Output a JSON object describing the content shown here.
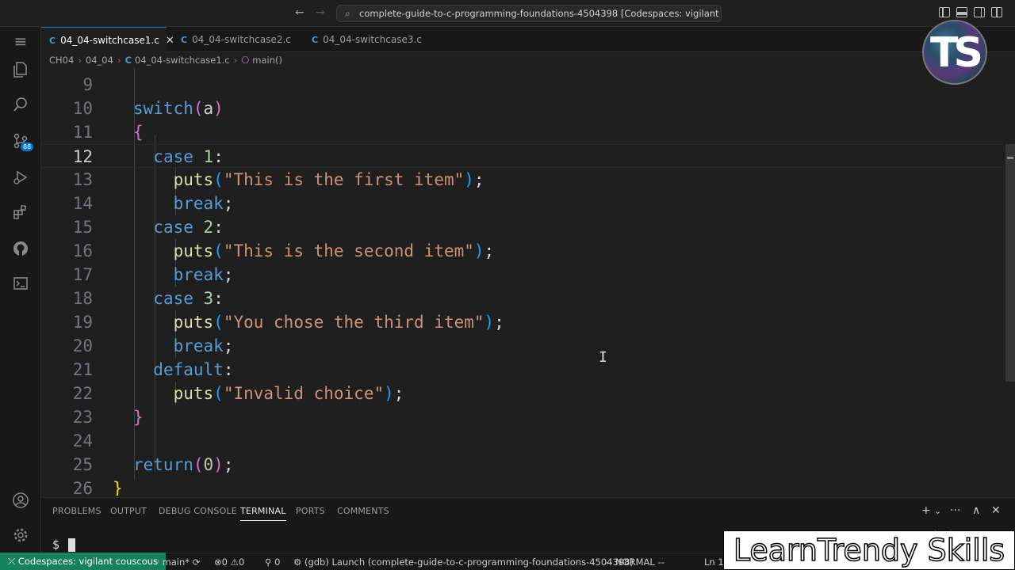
{
  "titlebar": {
    "back_icon": "←",
    "forward_icon": "→",
    "command_center": "complete-guide-to-c-programming-foundations-4504398 [Codespaces: vigilant couscous]"
  },
  "activity_bar": {
    "menu_icon": "≡",
    "extensions_badge": "88"
  },
  "tabs": [
    {
      "icon": "C",
      "label": "04_04-switchcase1.c",
      "close": "✕"
    },
    {
      "icon": "C",
      "label": "04_04-switchcase2.c"
    },
    {
      "icon": "C",
      "label": "04_04-switchcase3.c"
    }
  ],
  "breadcrumb": {
    "items": [
      "CH04",
      "04_04",
      "04_04-switchcase1.c",
      "main()"
    ],
    "file_icon": "C",
    "fn_icon": "⎔"
  },
  "editor": {
    "line_numbers": [
      "9",
      "10",
      "11",
      "12",
      "13",
      "14",
      "15",
      "16",
      "17",
      "18",
      "19",
      "20",
      "21",
      "22",
      "23",
      "24",
      "25",
      "26"
    ],
    "current_line": "12",
    "code": {
      "l10": {
        "kw": "switch",
        "open": "(",
        "var": "a",
        "close": ")"
      },
      "l11": "{",
      "l12": {
        "kw": "case",
        "num": "1",
        "colon": ":"
      },
      "l13": {
        "fn": "puts",
        "open": "(",
        "str": "\"This is the first item\"",
        "close": ")",
        "semi": ";"
      },
      "l14": {
        "kw": "break",
        "semi": ";"
      },
      "l15": {
        "kw": "case",
        "num": "2",
        "colon": ":"
      },
      "l16": {
        "fn": "puts",
        "open": "(",
        "str": "\"This is the second item\"",
        "close": ")",
        "semi": ";"
      },
      "l17": {
        "kw": "break",
        "semi": ";"
      },
      "l18": {
        "kw": "case",
        "num": "3",
        "colon": ":"
      },
      "l19": {
        "fn": "puts",
        "open": "(",
        "str": "\"You chose the third item\"",
        "close": ")",
        "semi": ";"
      },
      "l20": {
        "kw": "break",
        "semi": ";"
      },
      "l21": {
        "kw": "default",
        "colon": ":"
      },
      "l22": {
        "fn": "puts",
        "open": "(",
        "str": "\"Invalid choice\"",
        "close": ")",
        "semi": ";"
      },
      "l23": "}",
      "l25": {
        "kw": "return",
        "open": "(",
        "num": "0",
        "close": ")",
        "semi": ";"
      },
      "l26": "}"
    },
    "text_cursor": "I"
  },
  "panel": {
    "tabs": [
      "PROBLEMS",
      "OUTPUT",
      "DEBUG CONSOLE",
      "TERMINAL",
      "PORTS",
      "COMMENTS"
    ],
    "active_tab": "TERMINAL",
    "controls": {
      "add": "+",
      "dropdown": "⌄",
      "more": "···",
      "maximize": "∧",
      "close": "✕"
    },
    "prompt": "$",
    "shell_label": "bash"
  },
  "statusbar": {
    "remote": "Codespaces: vigilant couscous",
    "branch": "main*",
    "sync_icon": "⟳",
    "errors": "0",
    "warnings": "0",
    "ports": "0",
    "debug": "(gdb) Launch (complete-guide-to-c-programming-foundations-4504398)",
    "vim_mode": "-- NORMAL --",
    "position": "Ln 1"
  },
  "overlays": {
    "logo_text": "TS",
    "watermark": "LearnTrendy Skills"
  },
  "colors": {
    "keyword": "#569cd6",
    "function": "#dcdcaa",
    "string": "#ce9178",
    "number": "#b5cea8",
    "remote_indicator": "#16825d"
  }
}
